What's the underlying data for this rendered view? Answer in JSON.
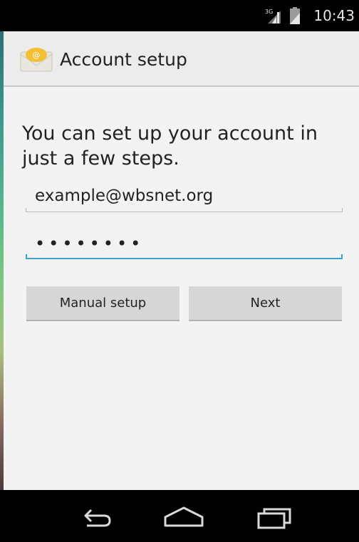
{
  "status_bar": {
    "network_type": "3G",
    "time": "10:43"
  },
  "action_bar": {
    "icon": "email-app-icon",
    "icon_glyph": "@",
    "title": "Account setup"
  },
  "content": {
    "intro": "You can set up your account in just a few steps.",
    "email": {
      "value": "example@wbsnet.org"
    },
    "password": {
      "value": "••••••••"
    },
    "buttons": {
      "manual_setup": "Manual setup",
      "next": "Next"
    }
  },
  "nav_bar": {
    "back_icon": "back-icon",
    "home_icon": "home-icon",
    "recent_icon": "recent-apps-icon"
  },
  "colors": {
    "accent": "#3aa0cf",
    "background": "#f3f3f3",
    "button": "#d6d6d6"
  }
}
